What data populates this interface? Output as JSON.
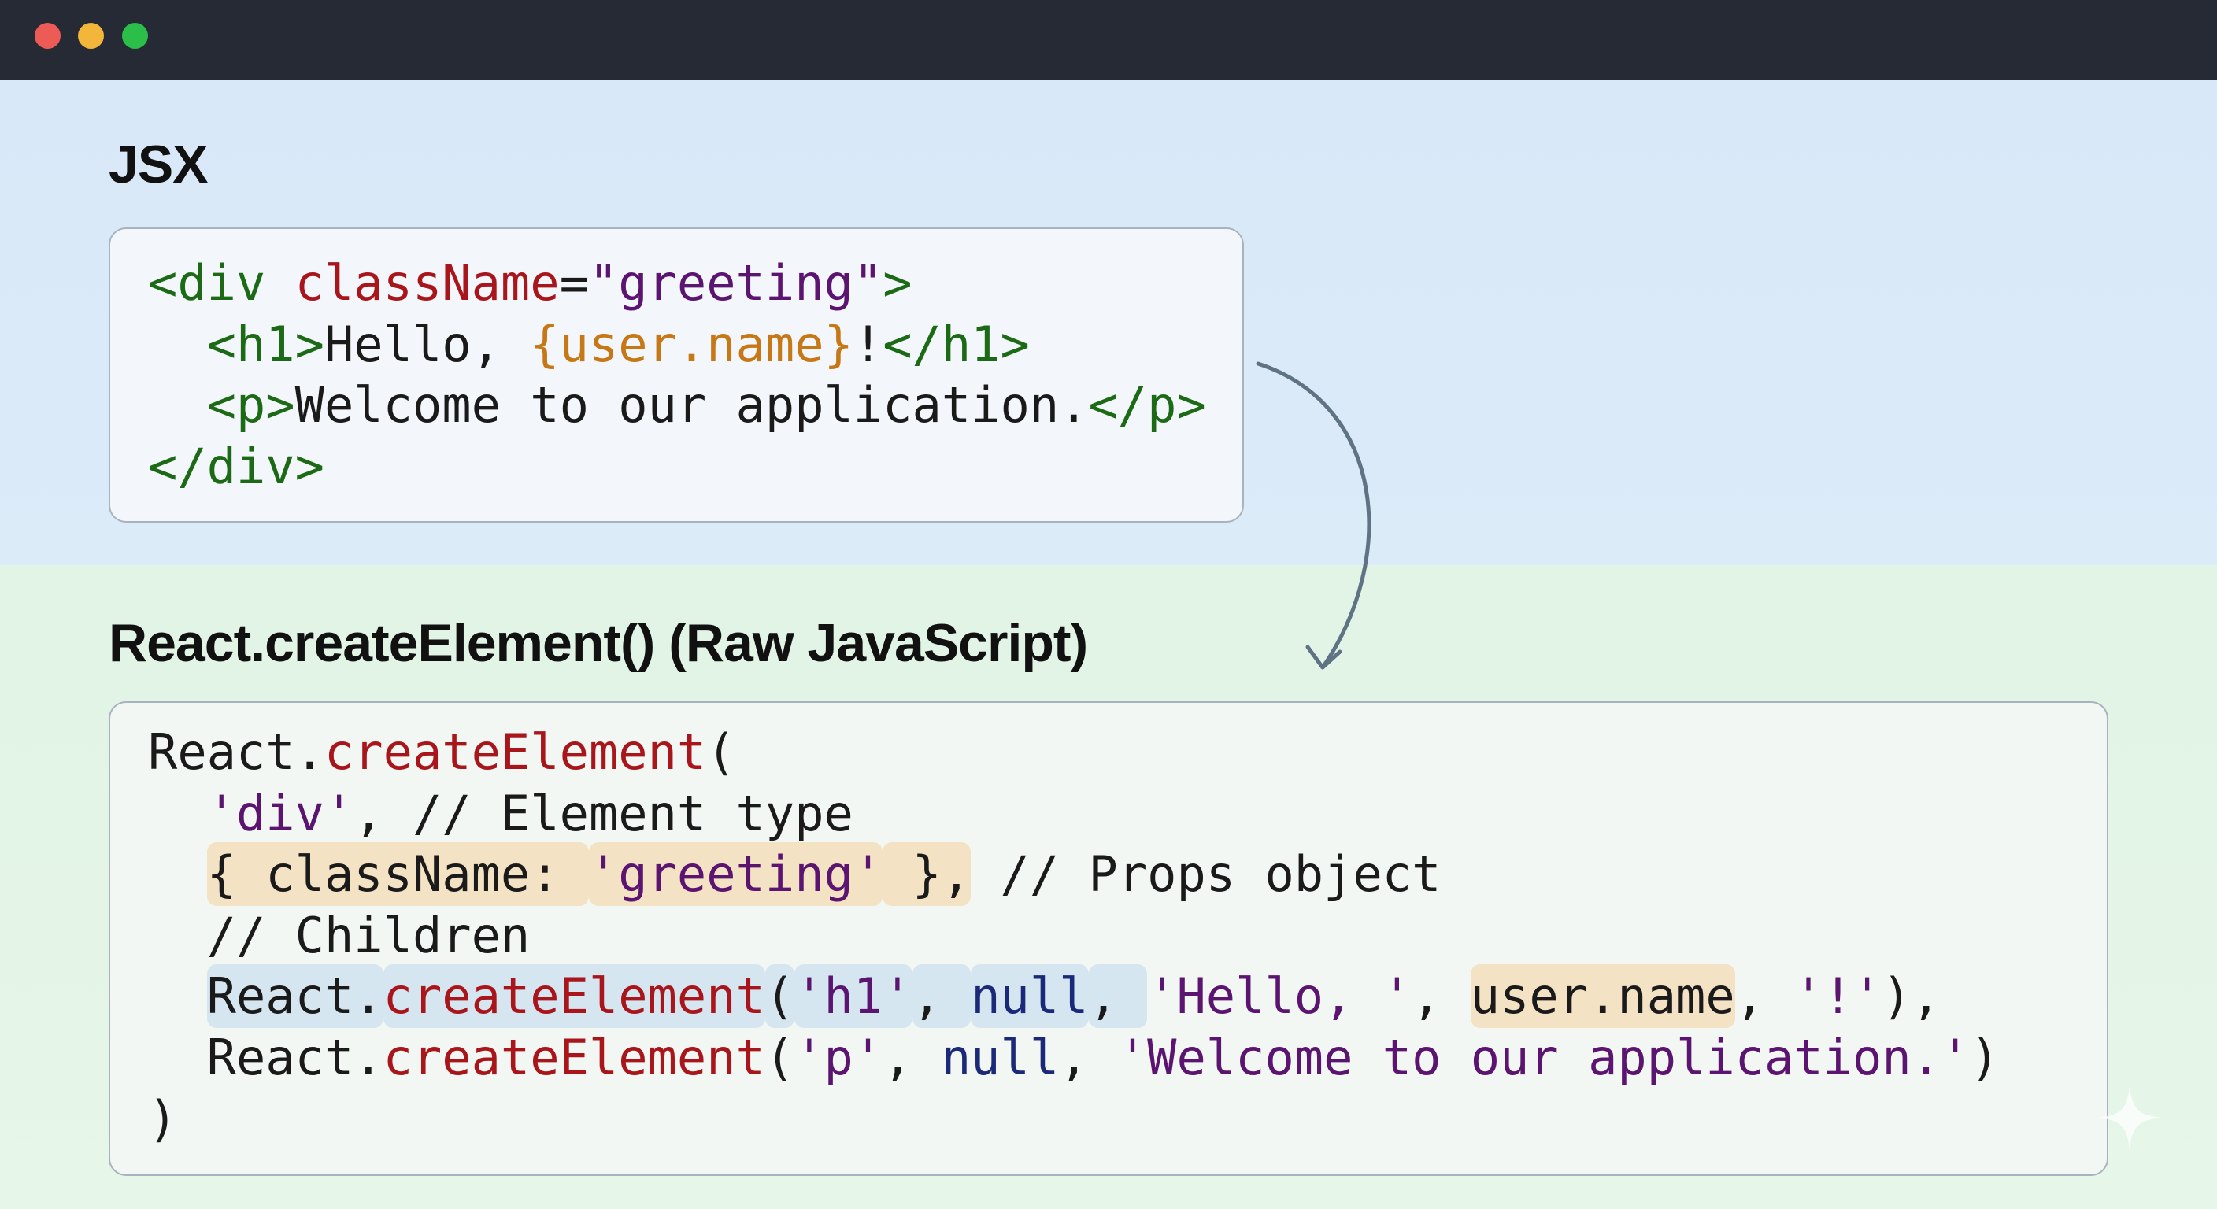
{
  "window": {
    "controls": [
      "close",
      "minimize",
      "maximize"
    ],
    "colors": {
      "titlebar": "#262a35",
      "close": "#ec5b55",
      "minimize": "#f2b73a",
      "maximize": "#2bbf4a"
    }
  },
  "sections": {
    "jsx": {
      "heading": "JSX",
      "background": "#d9e8f8",
      "code_lines": [
        [
          {
            "text": "<div ",
            "kind": "tag"
          },
          {
            "text": "className",
            "kind": "attr"
          },
          {
            "text": "=",
            "kind": "plain"
          },
          {
            "text": "\"greeting\"",
            "kind": "string"
          },
          {
            "text": ">",
            "kind": "tag"
          }
        ],
        [
          {
            "text": "  ",
            "kind": "plain"
          },
          {
            "text": "<h1>",
            "kind": "tag"
          },
          {
            "text": "Hello, ",
            "kind": "plain"
          },
          {
            "text": "{user.name}",
            "kind": "expr"
          },
          {
            "text": "!",
            "kind": "plain"
          },
          {
            "text": "</h1>",
            "kind": "tag"
          }
        ],
        [
          {
            "text": "  ",
            "kind": "plain"
          },
          {
            "text": "<p>",
            "kind": "tag"
          },
          {
            "text": "Welcome to our application.",
            "kind": "plain"
          },
          {
            "text": "</p>",
            "kind": "tag"
          }
        ],
        [
          {
            "text": "</div>",
            "kind": "tag"
          }
        ]
      ]
    },
    "raw": {
      "heading": "React.createElement() (Raw JavaScript)",
      "background": "#e1f4e6",
      "code_lines": [
        [
          {
            "text": "React.",
            "kind": "plain"
          },
          {
            "text": "createElement",
            "kind": "fn"
          },
          {
            "text": "(",
            "kind": "plain"
          }
        ],
        [
          {
            "text": "  ",
            "kind": "plain"
          },
          {
            "text": "'div'",
            "kind": "string"
          },
          {
            "text": ", // Element type",
            "kind": "plain"
          }
        ],
        [
          {
            "text": "  ",
            "kind": "plain"
          },
          {
            "text": "{ className: ",
            "kind": "plain",
            "highlight": "tan"
          },
          {
            "text": "'greeting'",
            "kind": "string",
            "highlight": "tan"
          },
          {
            "text": " },",
            "kind": "plain",
            "highlight": "tan"
          },
          {
            "text": " // Props object",
            "kind": "plain"
          }
        ],
        [
          {
            "text": "  // Children",
            "kind": "plain"
          }
        ],
        [
          {
            "text": "  ",
            "kind": "plain"
          },
          {
            "text": "React.",
            "kind": "plain",
            "highlight": "blue"
          },
          {
            "text": "createElement",
            "kind": "fn",
            "highlight": "blue"
          },
          {
            "text": "(",
            "kind": "plain",
            "highlight": "blue"
          },
          {
            "text": "'h1'",
            "kind": "string",
            "highlight": "blue"
          },
          {
            "text": ", ",
            "kind": "plain",
            "highlight": "blue"
          },
          {
            "text": "null",
            "kind": "kw",
            "highlight": "blue"
          },
          {
            "text": ", ",
            "kind": "plain",
            "highlight": "blue"
          },
          {
            "text": "'Hello, '",
            "kind": "string"
          },
          {
            "text": ", ",
            "kind": "plain"
          },
          {
            "text": "user.name",
            "kind": "plain",
            "highlight": "tan"
          },
          {
            "text": ", ",
            "kind": "plain"
          },
          {
            "text": "'!'",
            "kind": "string"
          },
          {
            "text": "),",
            "kind": "plain"
          }
        ],
        [
          {
            "text": "  ",
            "kind": "plain"
          },
          {
            "text": "React.",
            "kind": "plain"
          },
          {
            "text": "createElement",
            "kind": "fn"
          },
          {
            "text": "(",
            "kind": "plain"
          },
          {
            "text": "'p'",
            "kind": "string"
          },
          {
            "text": ", ",
            "kind": "plain"
          },
          {
            "text": "null",
            "kind": "kw"
          },
          {
            "text": ", ",
            "kind": "plain"
          },
          {
            "text": "'Welcome to our application.'",
            "kind": "string"
          },
          {
            "text": ")",
            "kind": "plain"
          }
        ],
        [
          {
            "text": ")",
            "kind": "plain"
          }
        ]
      ]
    }
  },
  "syntax_colors": {
    "tag": "#1c6a16",
    "attr": "#a8161c",
    "string": "#5b1470",
    "expr": "#c77816",
    "plain": "#1a1a1a",
    "fn": "#a8161c",
    "kw": "#1b2a78",
    "highlight_tan": "#f3e2c4",
    "highlight_blue": "#d6e6f1"
  },
  "connector": {
    "from": "jsx",
    "to": "raw",
    "icon": "curved-arrow-icon",
    "color": "#5f7384"
  },
  "watermark": {
    "icon": "sparkle-icon"
  }
}
